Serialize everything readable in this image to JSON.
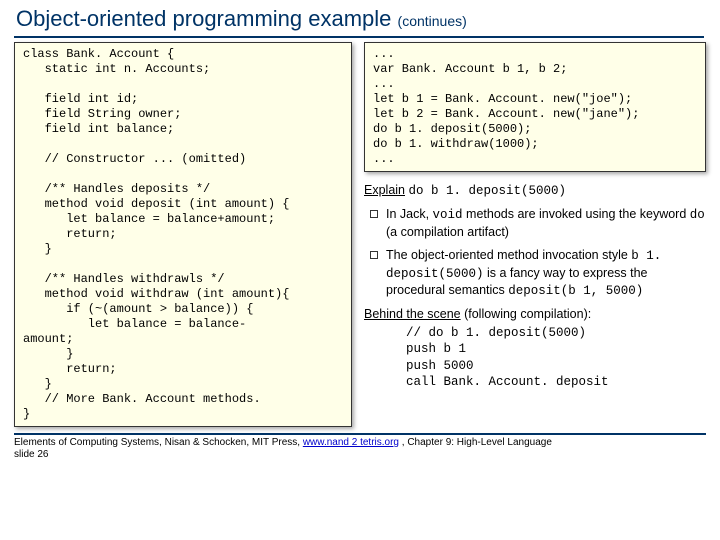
{
  "title": "Object-oriented programming example",
  "title_cont": "(continues)",
  "left_code": "class Bank. Account {\n   static int n. Accounts;\n\n   field int id;\n   field String owner;\n   field int balance;\n\n   // Constructor ... (omitted)\n\n   /** Handles deposits */\n   method void deposit (int amount) {\n      let balance = balance+amount;\n      return;\n   }\n\n   /** Handles withdrawls */\n   method void withdraw (int amount){\n      if (~(amount > balance)) {\n         let balance = balance-\namount;\n      }\n      return;\n   }\n   // More Bank. Account methods.\n}",
  "right_code": "...\nvar Bank. Account b 1, b 2;\n...\nlet b 1 = Bank. Account. new(\"joe\");\nlet b 2 = Bank. Account. new(\"jane\");\ndo b 1. deposit(5000);\ndo b 1. withdraw(1000);\n...",
  "explain_label": "Explain",
  "explain_code": "do b 1. deposit(5000)",
  "bul1_a": "In Jack, ",
  "bul1_b": "void",
  "bul1_c": " methods are invoked using the keyword ",
  "bul1_d": "do",
  "bul1_e": " (a compilation artifact)",
  "bul2_a": "The object-oriented method invocation style ",
  "bul2_b": "b 1. deposit(5000)",
  "bul2_c": " is a fancy way to express the procedural semantics ",
  "bul2_d": "deposit(b 1, 5000)",
  "behind_label": "Behind the scene",
  "behind_paren": " (following compilation):",
  "behind_code": "// do b 1. deposit(5000)\npush b 1\npush 5000\ncall Bank. Account. deposit",
  "footer_a": "Elements of Computing Systems, Nisan & Schocken, MIT Press, ",
  "footer_link": "www.nand 2 tetris.org",
  "footer_b": " , Chapter 9: High-Level Language",
  "footer_slide": "slide 26"
}
